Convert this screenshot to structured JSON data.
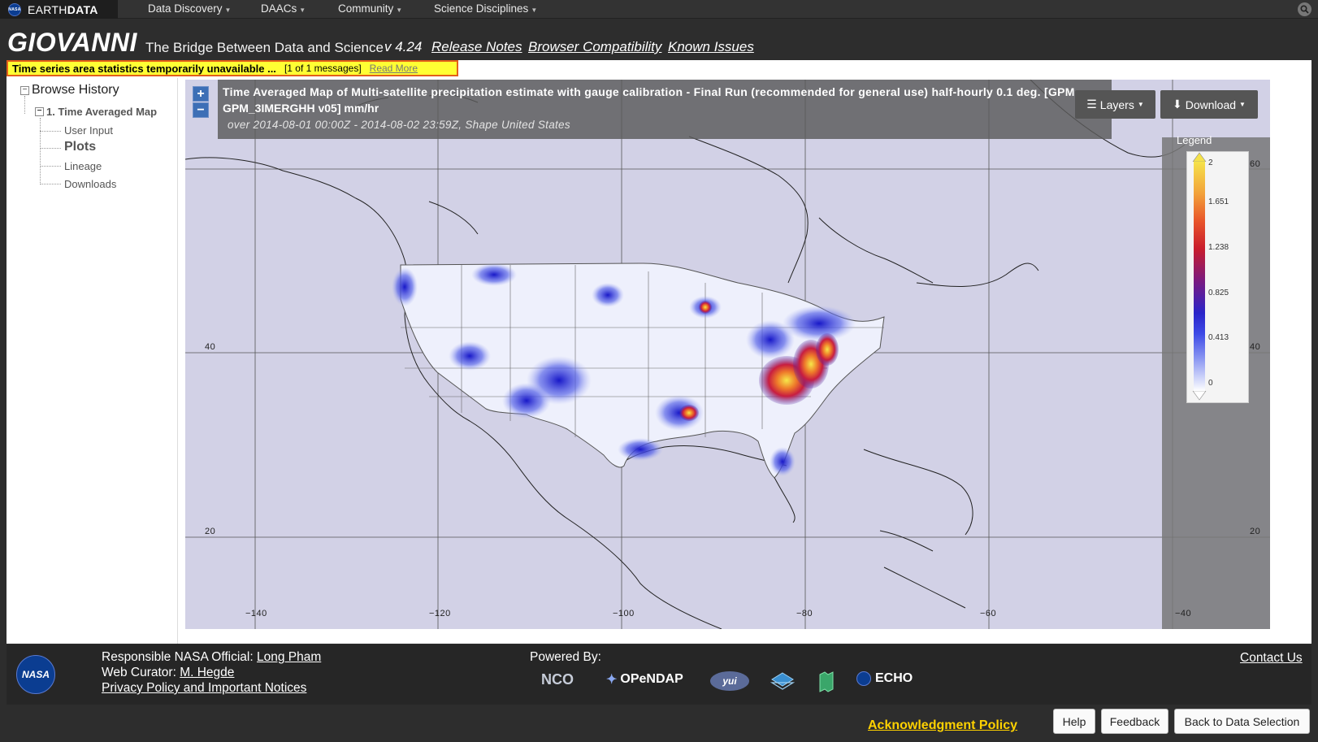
{
  "topnav": {
    "brand_a": "EARTH",
    "brand_b": "DATA",
    "nasa_mark": "NASA",
    "items": [
      "Data Discovery",
      "DAACs",
      "Community",
      "Science Disciplines"
    ],
    "search_icon": "search-icon"
  },
  "header": {
    "app_name": "GIOVANNI",
    "tagline": "The Bridge Between Data and Science",
    "version": "v 4.24",
    "links": [
      "Release Notes",
      "Browser Compatibility",
      "Known Issues"
    ]
  },
  "alert": {
    "message": "Time series area statistics temporarily unavailable ...",
    "count": "[1 of 1 messages]",
    "read_more": "Read More",
    "colors": {
      "background": "#ffff33",
      "border": "#e35f1a"
    }
  },
  "tree": {
    "root": "Browse History",
    "child": "1. Time Averaged Map",
    "leaves": [
      "User Input",
      "Plots",
      "Lineage",
      "Downloads"
    ],
    "selected": "Plots"
  },
  "map": {
    "title_line1": "Time Averaged Map of Multi-satellite precipitation estimate with gauge calibration - Final Run (recommended for general use) half-hourly 0.1 deg. [GPM",
    "title_line2": "GPM_3IMERGHH v05] mm/hr",
    "subtitle": "over 2014-08-01 00:00Z - 2014-08-02 23:59Z, Shape United States",
    "zoom_in": "+",
    "zoom_out": "−",
    "layers_label": "Layers",
    "download_label": "Download",
    "legend_title": "Legend",
    "legend_values": [
      "2",
      "1.651",
      "1.238",
      "0.825",
      "0.413",
      "0"
    ],
    "lat_labels": [
      "60",
      "40",
      "20"
    ],
    "lon_labels": [
      "−140",
      "−120",
      "−100",
      "−80",
      "−60",
      "−40"
    ],
    "colors": {
      "background": "#d2d1e6",
      "overlay": "#5a5a5a",
      "button": "#555555"
    }
  },
  "footer": {
    "official_label": "Responsible NASA Official:",
    "official_name": "Long Pham",
    "curator_label": "Web Curator:",
    "curator_name": "M. Hegde",
    "privacy": "Privacy Policy and Important Notices",
    "powered_by": "Powered By:",
    "logos": [
      "NCO",
      "OPeNDAP",
      "yui",
      "ECHO"
    ],
    "nasa_logo": "NASA",
    "contact": "Contact Us"
  },
  "bottom": {
    "ack": "Acknowledgment Policy",
    "buttons": [
      "Help",
      "Feedback",
      "Back to Data Selection"
    ]
  }
}
